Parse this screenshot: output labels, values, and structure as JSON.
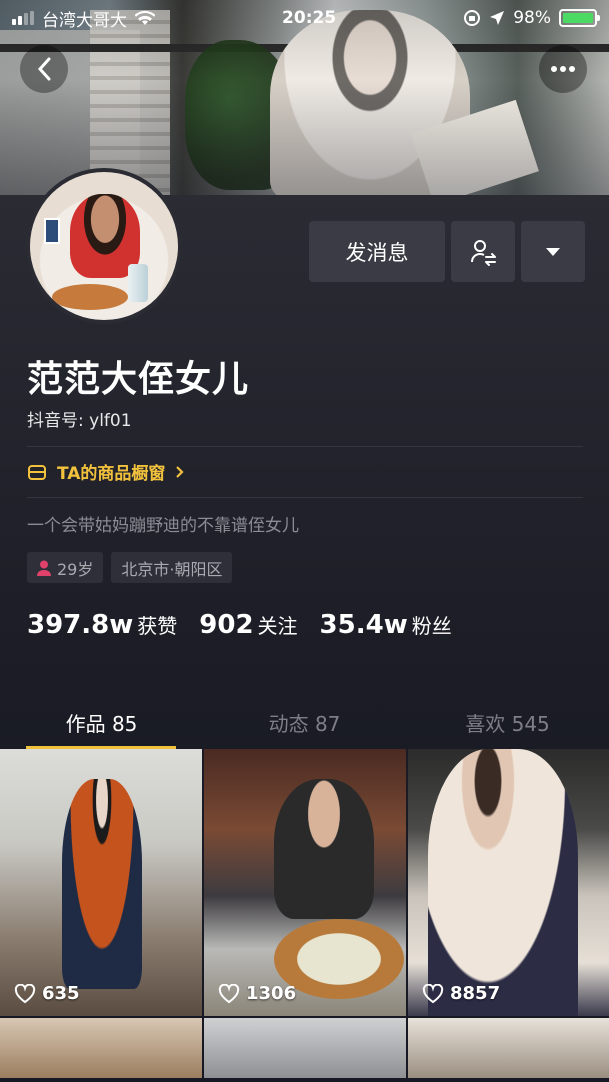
{
  "status_bar": {
    "carrier": "台湾大哥大",
    "time": "20:25",
    "battery": "98%"
  },
  "nav": {
    "back_icon": "chevron-left-icon",
    "more_icon": "more-horizontal-icon"
  },
  "actions": {
    "message_label": "发消息"
  },
  "profile": {
    "nickname": "范范大侄女儿",
    "douyin_id": "抖音号: ylf01",
    "shop_label": "TA的商品橱窗",
    "bio": "一个会带姑妈蹦野迪的不靠谱侄女儿",
    "tags": [
      "29岁",
      "北京市·朝阳区"
    ]
  },
  "stats": [
    {
      "num": "397.8w",
      "label": "获赞"
    },
    {
      "num": "902",
      "label": "关注"
    },
    {
      "num": "35.4w",
      "label": "粉丝"
    }
  ],
  "tabs": [
    {
      "label": "作品 85",
      "active": true
    },
    {
      "label": "动态 87",
      "active": false
    },
    {
      "label": "喜欢 545",
      "active": false
    }
  ],
  "videos": [
    {
      "likes": "635"
    },
    {
      "likes": "1306"
    },
    {
      "likes": "8857"
    }
  ],
  "colors": {
    "accent": "#f3c23d",
    "background": "#161823",
    "button": "#3a3b44"
  }
}
